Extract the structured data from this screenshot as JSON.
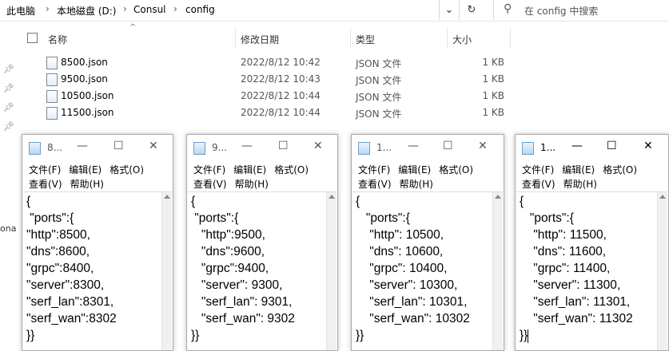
{
  "explorer": {
    "breadcrumb": [
      "此电脑",
      "本地磁盘 (D:)",
      "Consul",
      "config"
    ],
    "search_placeholder": "在 config 中搜索",
    "columns": {
      "name": "名称",
      "date": "修改日期",
      "type": "类型",
      "size": "大小"
    },
    "files": [
      {
        "name": "8500.json",
        "date": "2022/8/12 10:42",
        "type": "JSON 文件",
        "size": "1 KB"
      },
      {
        "name": "9500.json",
        "date": "2022/8/12 10:43",
        "type": "JSON 文件",
        "size": "1 KB"
      },
      {
        "name": "10500.json",
        "date": "2022/8/12 10:44",
        "type": "JSON 文件",
        "size": "1 KB"
      },
      {
        "name": "11500.json",
        "date": "2022/8/12 10:44",
        "type": "JSON 文件",
        "size": "1 KB"
      }
    ],
    "left_edge_text": "ona"
  },
  "notepad_menu": {
    "file": "文件(F)",
    "edit": "编辑(E)",
    "format": "格式(O)",
    "view": "查看(V)",
    "help": "帮助(H)"
  },
  "notepads": [
    {
      "title": "8...",
      "lines": [
        "{",
        " \"ports\":{",
        "\"http\":8500,",
        "\"dns\":8600,",
        "\"grpc\":8400,",
        "\"server\":8300,",
        "\"serf_lan\":8301,",
        "\"serf_wan\":8302",
        "}}"
      ]
    },
    {
      "title": "9...",
      "lines": [
        "{",
        " \"ports\":{",
        "   \"http\":9500,",
        "   \"dns\":9600,",
        "   \"grpc\":9400,",
        "   \"server\": 9300,",
        "   \"serf_lan\": 9301,",
        "   \"serf_wan\": 9302",
        "}}"
      ]
    },
    {
      "title": "1...",
      "lines": [
        "{",
        "   \"ports\":{",
        "    \"http\": 10500,",
        "    \"dns\": 10600,",
        "    \"grpc\": 10400,",
        "    \"server\": 10300,",
        "    \"serf_lan\": 10301,",
        "    \"serf_wan\": 10302",
        "}}"
      ]
    },
    {
      "title": "1...",
      "lines": [
        "{",
        "   \"ports\":{",
        "    \"http\": 11500,",
        "    \"dns\": 11600,",
        "    \"grpc\": 11400,",
        "    \"server\": 11300,",
        "    \"serf_lan\": 11301,",
        "    \"serf_wan\": 11302",
        "}}"
      ]
    }
  ]
}
